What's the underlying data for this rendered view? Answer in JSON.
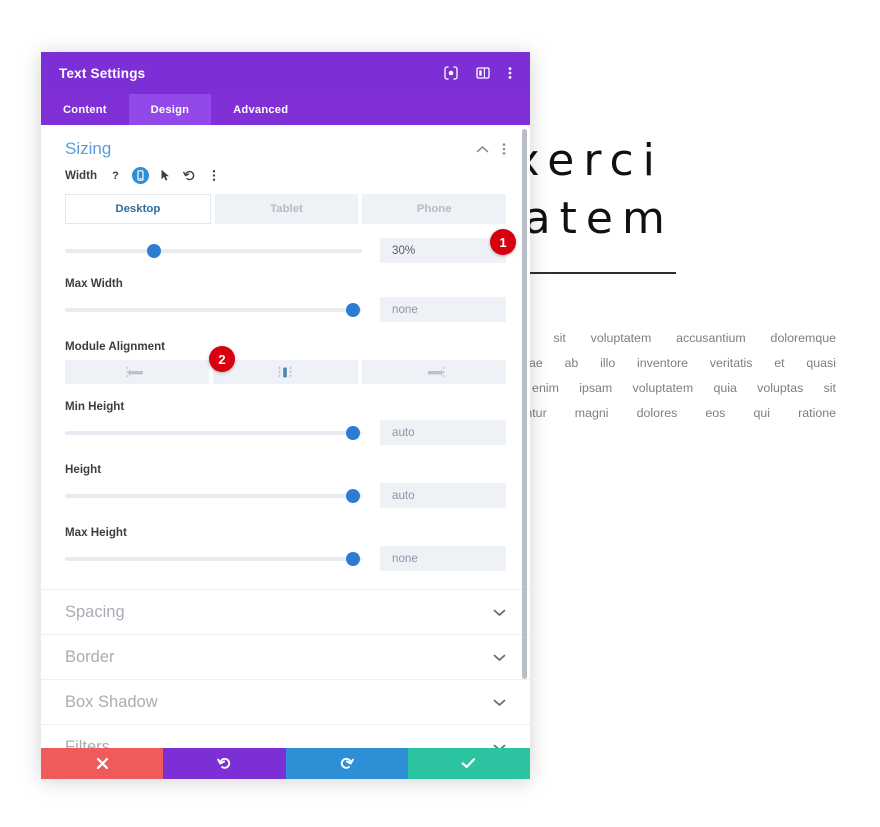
{
  "panel": {
    "title": "Text Settings",
    "header_icons": [
      {
        "name": "focus-target-icon",
        "glyph": "target"
      },
      {
        "name": "panel-layout-icon",
        "glyph": "layout"
      },
      {
        "name": "more-options-icon",
        "glyph": "dots"
      }
    ],
    "tabs": [
      {
        "label": "Content",
        "active": false
      },
      {
        "label": "Design",
        "active": true
      },
      {
        "label": "Advanced",
        "active": false
      }
    ],
    "section": {
      "title": "Sizing",
      "collapse_icon": "chevron-up-icon",
      "more_icon": "more-options-icon"
    },
    "width": {
      "label": "Width",
      "icons": [
        {
          "name": "help-icon",
          "glyph": "?"
        },
        {
          "name": "responsive-device-icon",
          "glyph": "device"
        },
        {
          "name": "hover-cursor-icon",
          "glyph": "cursor"
        },
        {
          "name": "reset-icon",
          "glyph": "undo"
        },
        {
          "name": "more-options-icon",
          "glyph": "dots"
        }
      ],
      "devices": [
        {
          "label": "Desktop",
          "active": true
        },
        {
          "label": "Tablet",
          "active": false
        },
        {
          "label": "Phone",
          "active": false
        }
      ],
      "slider_percent": 30,
      "value": "30%"
    },
    "max_width": {
      "label": "Max Width",
      "slider_percent": 97,
      "value": "",
      "placeholder": "none"
    },
    "module_alignment": {
      "label": "Module Alignment",
      "options": [
        {
          "name": "align-left-icon",
          "active": false
        },
        {
          "name": "align-center-icon",
          "active": true
        },
        {
          "name": "align-right-icon",
          "active": false
        }
      ]
    },
    "min_height": {
      "label": "Min Height",
      "slider_percent": 97,
      "value": "",
      "placeholder": "auto"
    },
    "height": {
      "label": "Height",
      "slider_percent": 97,
      "value": "",
      "placeholder": "auto"
    },
    "max_height": {
      "label": "Max Height",
      "slider_percent": 97,
      "value": "",
      "placeholder": "none"
    },
    "collapsed_sections": [
      {
        "label": "Spacing"
      },
      {
        "label": "Border"
      },
      {
        "label": "Box Shadow"
      },
      {
        "label": "Filters"
      }
    ],
    "actions": [
      {
        "name": "cancel-button",
        "icon": "close-icon",
        "color": "#ef5a5a"
      },
      {
        "name": "undo-button",
        "icon": "undo-icon",
        "color": "#7b2fd4"
      },
      {
        "name": "redo-button",
        "icon": "redo-icon",
        "color": "#2d8fd5"
      },
      {
        "name": "save-button",
        "icon": "check-icon",
        "color": "#2cc4a0"
      }
    ]
  },
  "page": {
    "heading_line1": "ud  Exerci",
    "heading_line2": "ocritatem",
    "body_lines": [
      "s iste natus error sit voluptatem accusantium doloremque",
      "am, eaque ipsa quae ab illo inventore veritatis et quasi",
      "nt explicabo. Nemo enim ipsam voluptatem quia voluptas sit",
      "sed quia consequuntur magni dolores eos qui ratione"
    ]
  },
  "callouts": [
    {
      "number": "1"
    },
    {
      "number": "2"
    }
  ],
  "colors": {
    "header_purple": "#7b2fd4",
    "tab_purple": "#8130d8",
    "tab_active_purple": "#9348e8",
    "accent_blue": "#2d7cd4",
    "section_title_blue": "#5b9dd9",
    "badge_red": "#d8000f",
    "save_green": "#2cc4a0"
  }
}
